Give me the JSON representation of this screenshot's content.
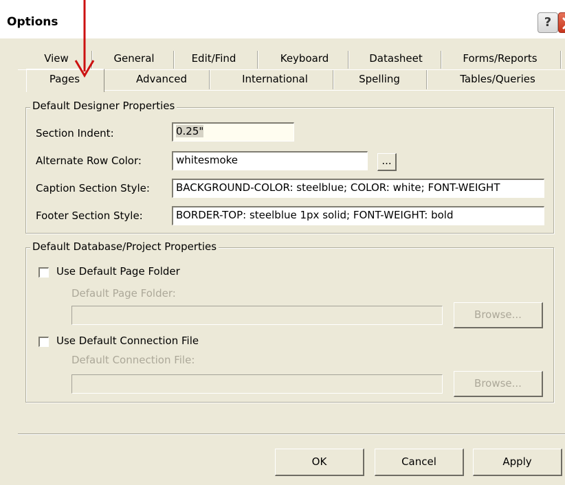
{
  "window": {
    "title": "Options",
    "help_label": "?"
  },
  "tabs_row1": [
    "View",
    "General",
    "Edit/Find",
    "Keyboard",
    "Datasheet",
    "Forms/Reports"
  ],
  "tabs_row2": [
    "Pages",
    "Advanced",
    "International",
    "Spelling",
    "Tables/Queries"
  ],
  "active_tab": "Pages",
  "designer_group": {
    "title": "Default Designer Properties",
    "section_indent_label": "Section Indent:",
    "section_indent_value": "0.25\"",
    "alt_row_color_label": "Alternate Row Color:",
    "alt_row_color_value": "whitesmoke",
    "alt_row_color_button": "...",
    "caption_style_label": "Caption Section Style:",
    "caption_style_value": "BACKGROUND-COLOR: steelblue; COLOR: white; FONT-WEIGHT",
    "footer_style_label": "Footer Section Style:",
    "footer_style_value": "BORDER-TOP: steelblue 1px solid; FONT-WEIGHT: bold"
  },
  "database_group": {
    "title": "Default Database/Project Properties",
    "use_page_folder_label": "Use Default Page Folder",
    "use_page_folder_checked": false,
    "page_folder_label": "Default Page Folder:",
    "page_folder_value": "",
    "browse_label_1": "Browse...",
    "use_connection_label": "Use Default Connection File",
    "use_connection_checked": false,
    "connection_label": "Default Connection File:",
    "connection_value": "",
    "browse_label_2": "Browse..."
  },
  "buttons": {
    "ok": "OK",
    "cancel": "Cancel",
    "apply": "Apply"
  },
  "colors": {
    "face": "#ece9d8",
    "annotation_arrow": "#cc1111",
    "disabled_text": "#aca899"
  }
}
